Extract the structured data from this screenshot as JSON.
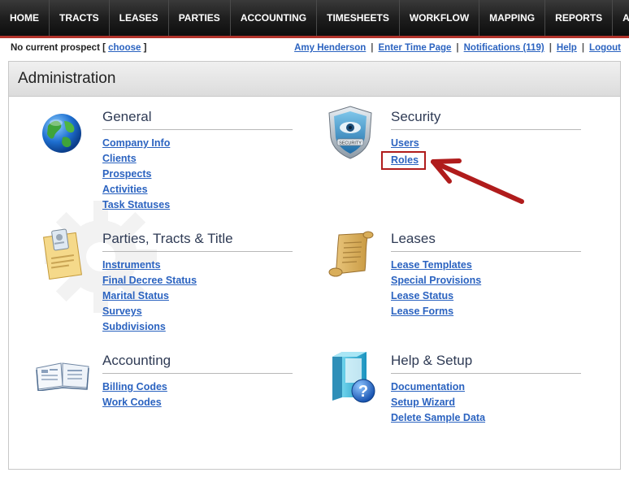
{
  "nav": {
    "items": [
      "HOME",
      "TRACTS",
      "LEASES",
      "PARTIES",
      "ACCOUNTING",
      "TIMESHEETS",
      "WORKFLOW",
      "MAPPING",
      "REPORTS",
      "ADMIN"
    ]
  },
  "status": {
    "prospect_prefix": "No current prospect [",
    "choose_link": "choose",
    "prospect_suffix": "]",
    "user": "Amy Henderson",
    "time_page": "Enter Time Page",
    "notifications": "Notifications (119)",
    "help": "Help",
    "logout": "Logout"
  },
  "page": {
    "title": "Administration"
  },
  "sections": {
    "general": {
      "title": "General",
      "links": [
        "Company Info",
        "Clients",
        "Prospects",
        "Activities",
        "Task Statuses"
      ]
    },
    "security": {
      "title": "Security",
      "links": [
        "Users",
        "Roles"
      ],
      "badge_text": "SECURITY"
    },
    "parties": {
      "title": "Parties, Tracts & Title",
      "links": [
        "Instruments",
        "Final Decree Status",
        "Marital Status",
        "Surveys",
        "Subdivisions"
      ]
    },
    "leases": {
      "title": "Leases",
      "links": [
        "Lease Templates",
        "Special Provisions",
        "Lease Status",
        "Lease Forms"
      ]
    },
    "accounting": {
      "title": "Accounting",
      "links": [
        "Billing Codes",
        "Work Codes"
      ]
    },
    "helpsetup": {
      "title": "Help & Setup",
      "links": [
        "Documentation",
        "Setup Wizard",
        "Delete Sample Data"
      ]
    }
  },
  "colors": {
    "accent_red": "#b01c1c",
    "link_blue": "#2b63c0",
    "nav_border": "#b2332b"
  },
  "icons": {
    "general": "globe-icon",
    "security": "security-shield-icon",
    "parties": "id-badge-document-icon",
    "leases": "scroll-icon",
    "accounting": "open-book-icon",
    "helpsetup": "help-box-icon"
  }
}
